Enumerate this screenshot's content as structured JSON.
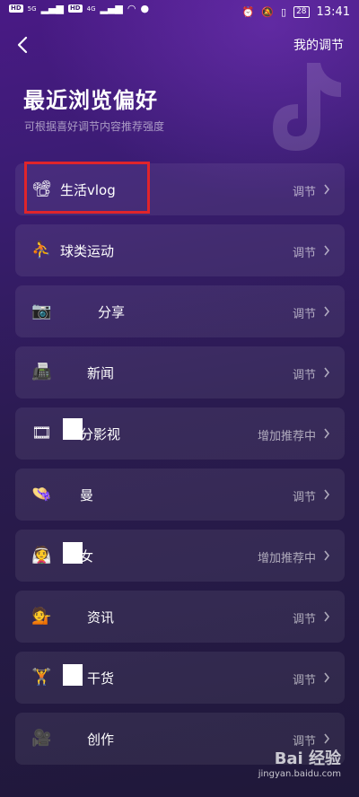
{
  "status_bar": {
    "left_tags": [
      "HD",
      "HD"
    ],
    "signal_1": "5G",
    "signal_2": "4G",
    "battery": "28",
    "time": "13:41"
  },
  "header": {
    "back_icon": "chevron-left-icon",
    "right_link": "我的调节"
  },
  "title": "最近浏览偏好",
  "subtitle": "可根据喜好调节内容推荐强度",
  "items": [
    {
      "icon": "📽",
      "label": "生活vlog",
      "action": "调节"
    },
    {
      "icon": "⛹",
      "label": "球类运动",
      "action": "调节"
    },
    {
      "icon": "📷",
      "label": "分享",
      "action": "调节"
    },
    {
      "icon": "📠",
      "label": "新闻",
      "action": "调节"
    },
    {
      "icon": "🎞",
      "label": "分影视",
      "action": "增加推荐中"
    },
    {
      "icon": "👒",
      "label": "曼",
      "action": "调节"
    },
    {
      "icon": "👰",
      "label": "女",
      "action": "增加推荐中"
    },
    {
      "icon": "💁",
      "label": "资讯",
      "action": "调节"
    },
    {
      "icon": "🏋",
      "label": "干货",
      "action": "调节"
    },
    {
      "icon": "🎥",
      "label": "创作",
      "action": "调节"
    }
  ],
  "watermark": {
    "logo": "Bai 经验",
    "url": "jingyan.baidu.com"
  },
  "colors": {
    "highlight": "#e0242b"
  }
}
